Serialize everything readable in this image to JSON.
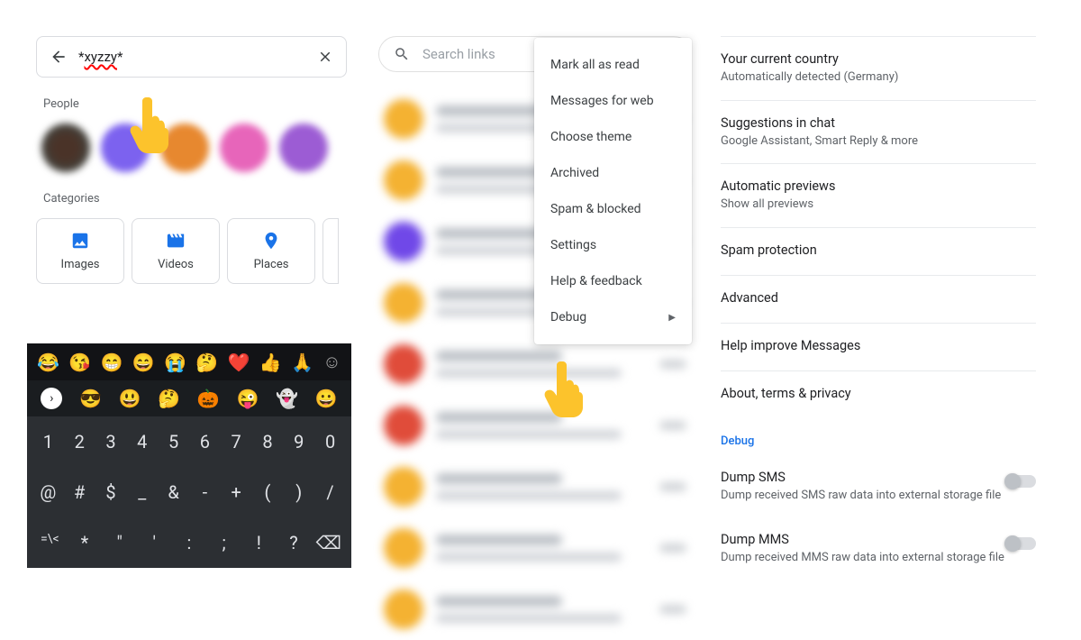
{
  "panel1": {
    "search_value_prefix": "*",
    "search_value_word": "xyzzy",
    "search_value_suffix": "*",
    "people_label": "People",
    "categories_label": "Categories",
    "categories": [
      {
        "label": "Images",
        "icon": "images"
      },
      {
        "label": "Videos",
        "icon": "videos"
      },
      {
        "label": "Places",
        "icon": "places"
      }
    ],
    "keyboard": {
      "emoji_row_1": [
        "😂",
        "😘",
        "😁",
        "😄",
        "😭",
        "🤔",
        "❤️",
        "👍",
        "🙏"
      ],
      "emoji_row_2": [
        "😎",
        "😃",
        "🤔",
        "🎃",
        "😜",
        "👻",
        "😀"
      ],
      "row_num": [
        "1",
        "2",
        "3",
        "4",
        "5",
        "6",
        "7",
        "8",
        "9",
        "0"
      ],
      "row_sym1": [
        "@",
        "#",
        "$",
        "_",
        "&",
        "-",
        "+",
        "(",
        ")",
        "/"
      ],
      "row_sym2": [
        "=\\<",
        "*",
        "\"",
        "'",
        ":",
        ";",
        "!",
        "?",
        "⌫"
      ]
    }
  },
  "panel2": {
    "search_placeholder": "Search links",
    "menu": [
      "Mark all as read",
      "Messages for web",
      "Choose theme",
      "Archived",
      "Spam & blocked",
      "Settings",
      "Help & feedback",
      "Debug"
    ]
  },
  "panel3": {
    "rows": [
      {
        "title": "Your current country",
        "sub": "Automatically detected (Germany)"
      },
      {
        "title": "Suggestions in chat",
        "sub": "Google Assistant, Smart Reply & more"
      },
      {
        "title": "Automatic previews",
        "sub": "Show all previews"
      },
      {
        "title": "Spam protection",
        "sub": ""
      },
      {
        "title": "Advanced",
        "sub": ""
      },
      {
        "title": "Help improve Messages",
        "sub": ""
      },
      {
        "title": "About, terms & privacy",
        "sub": ""
      }
    ],
    "debug_heading": "Debug",
    "debug_rows": [
      {
        "title": "Dump SMS",
        "sub": "Dump received SMS raw data into external storage file"
      },
      {
        "title": "Dump MMS",
        "sub": "Dump received MMS raw data into external storage file"
      }
    ]
  }
}
